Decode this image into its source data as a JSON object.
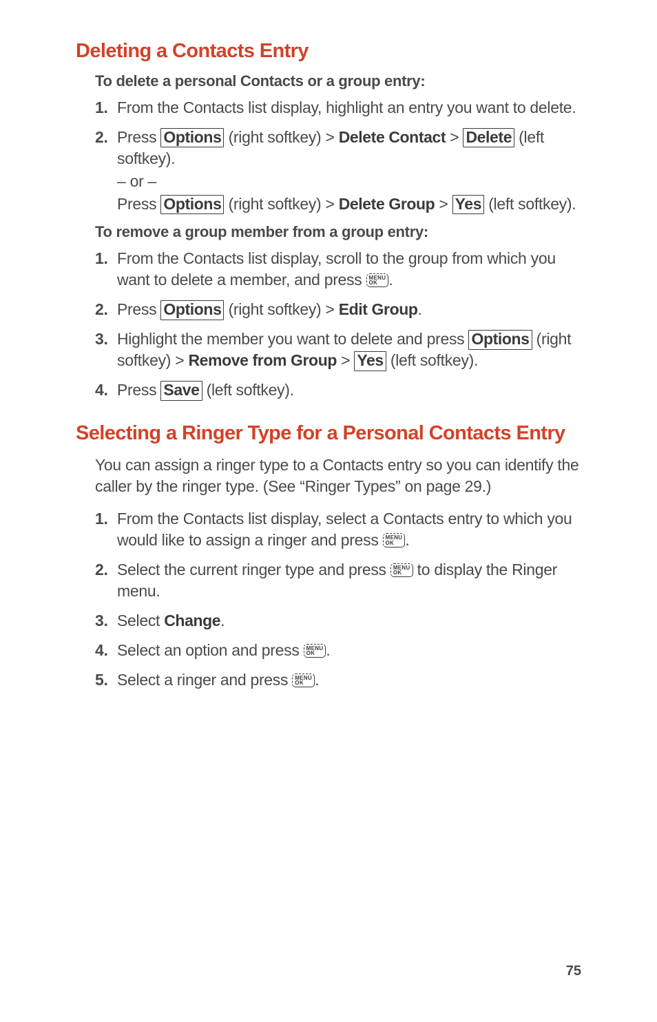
{
  "sections": {
    "s1": {
      "heading": "Deleting a Contacts Entry",
      "sub1": "To delete a personal Contacts or a group entry:",
      "steps1": {
        "n1": "1.",
        "t1": "From the Contacts list display, highlight an entry you want to delete.",
        "n2": "2.",
        "t2a": "Press ",
        "t2b": " (right softkey) > ",
        "t2c": " > ",
        "t2d": " (left softkey).",
        "or": "– or –",
        "t2e": "Press ",
        "t2f": " (right softkey) > ",
        "t2g": " > ",
        "t2h": " (left softkey)."
      },
      "sub2": "To remove a group member from a group entry:",
      "steps2": {
        "n1": "1.",
        "t1a": "From the Contacts list display, scroll to the group from which you want to delete a member, and press ",
        "t1b": ".",
        "n2": "2.",
        "t2a": "Press ",
        "t2b": " (right softkey) > ",
        "t2c": ".",
        "n3": "3.",
        "t3a": "Highlight the member you want to delete and press ",
        "t3b": " (right softkey) > ",
        "t3c": " > ",
        "t3d": " (left softkey).",
        "n4": "4.",
        "t4a": " Press ",
        "t4b": " (left softkey)."
      }
    },
    "s2": {
      "heading": "Selecting a Ringer Type for a Personal Contacts Entry",
      "body": "You can assign a ringer type to a Contacts entry so you can identify the caller by the ringer type. (See “Ringer Types” on page 29.)",
      "steps": {
        "n1": "1.",
        "t1a": "From the Contacts list display, select a Contacts entry to which you would like to assign a ringer and press ",
        "t1b": ".",
        "n2": "2.",
        "t2a": "Select the current ringer type and press ",
        "t2b": " to display the Ringer menu.",
        "n3": "3.",
        "t3a": "Select ",
        "t3b": ".",
        "n4": "4.",
        "t4a": "Select an option and press ",
        "t4b": ".",
        "n5": "5.",
        "t5a": "Select a ringer and press ",
        "t5b": "."
      }
    }
  },
  "keys": {
    "options": "Options",
    "delete": "Delete",
    "yes": "Yes",
    "save": "Save",
    "menu": "MENU",
    "ok": "OK"
  },
  "bold": {
    "delete_contact": "Delete Contact",
    "delete_group": "Delete Group",
    "edit_group": "Edit Group",
    "remove_from_group": "Remove from Group",
    "change": "Change"
  },
  "page_number": "75"
}
